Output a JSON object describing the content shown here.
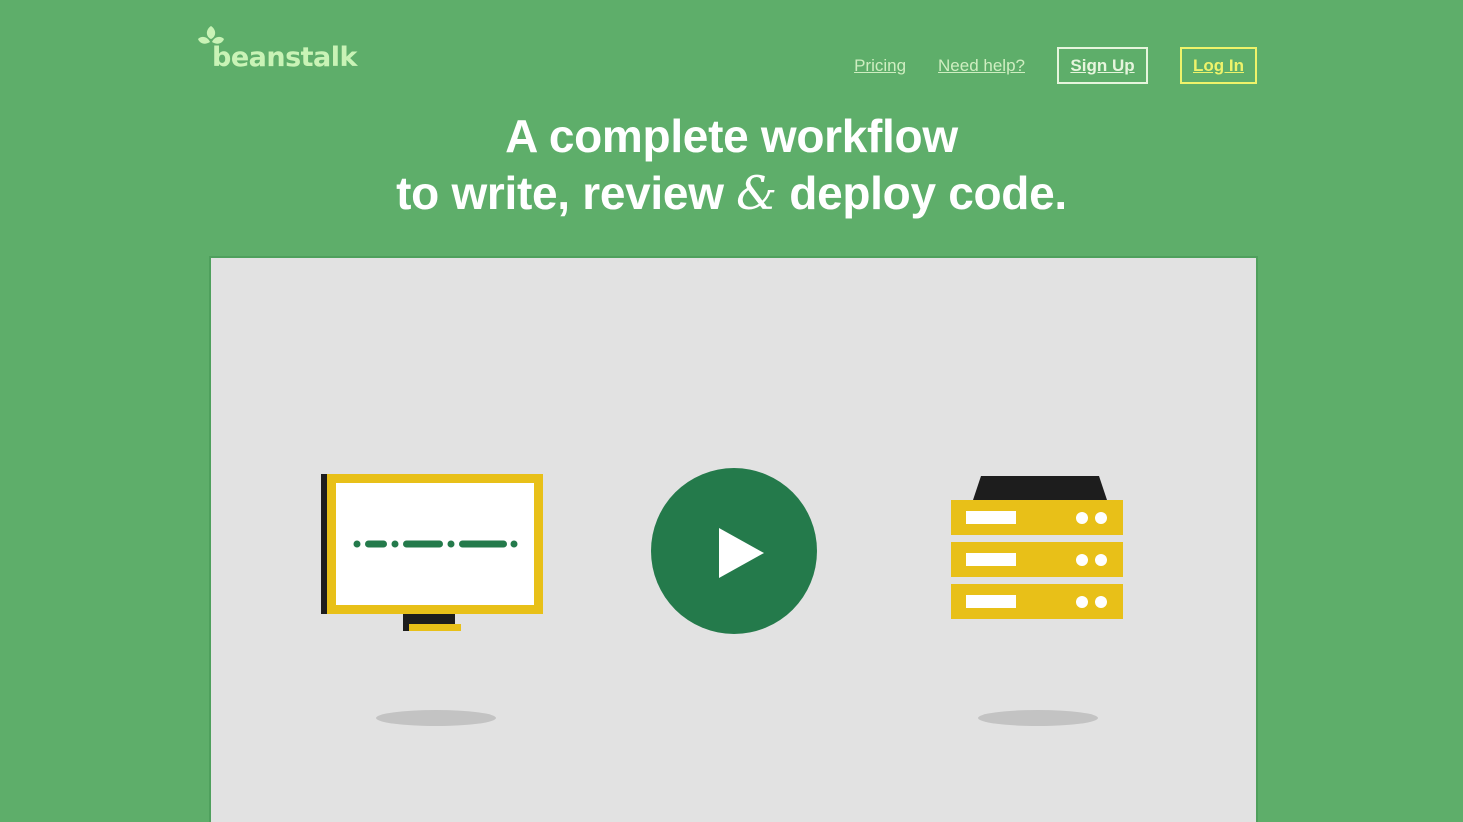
{
  "brand": {
    "name": "beanstalk"
  },
  "nav": {
    "pricing": "Pricing",
    "help": "Need help?",
    "signup": "Sign Up",
    "login": "Log In"
  },
  "hero": {
    "line1": "A complete workflow",
    "line2_before": "to write, review ",
    "line2_amp": "&",
    "line2_after": " deploy code."
  },
  "colors": {
    "background": "#5eae6a",
    "panel": "#e2e2e2",
    "play": "#247a4b",
    "yellow": "#e8c018",
    "login_accent": "#eef36a"
  },
  "icons": {
    "logo": "sprout-icon",
    "computer": "monitor-icon",
    "play": "play-icon",
    "server": "server-icon"
  }
}
